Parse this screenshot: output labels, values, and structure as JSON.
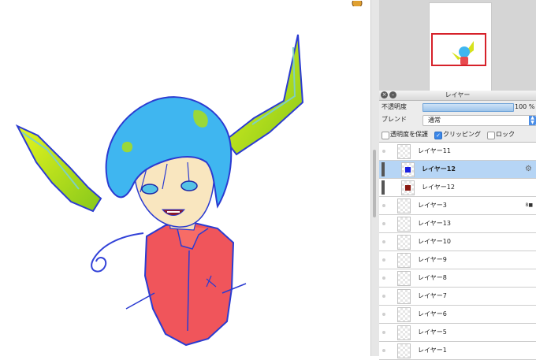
{
  "layer_panel": {
    "title": "レイヤー",
    "opacity_label": "不透明度",
    "opacity_value": "100 %",
    "opacity_fraction": 1.0,
    "blend_label": "ブレンド",
    "blend_value": "通常",
    "protect_transparency_label": "透明度を保護",
    "protect_transparency_checked": false,
    "clipping_label": "クリッピング",
    "clipping_checked": true,
    "lock_label": "ロック",
    "lock_checked": false,
    "layers": [
      {
        "name": "レイヤー11",
        "selected": false,
        "clipped": false
      },
      {
        "name": "レイヤー12",
        "selected": true,
        "clipped": true,
        "swatch": "#1b22e0"
      },
      {
        "name": "レイヤー12",
        "selected": false,
        "clipped": true,
        "swatch": "#8a1a12"
      },
      {
        "name": "レイヤー3",
        "selected": false,
        "clipped": false,
        "badge": "8■"
      },
      {
        "name": "レイヤー13",
        "selected": false,
        "clipped": false
      },
      {
        "name": "レイヤー10",
        "selected": false,
        "clipped": false
      },
      {
        "name": "レイヤー9",
        "selected": false,
        "clipped": false
      },
      {
        "name": "レイヤー8",
        "selected": false,
        "clipped": false
      },
      {
        "name": "レイヤー7",
        "selected": false,
        "clipped": false
      },
      {
        "name": "レイヤー6",
        "selected": false,
        "clipped": false
      },
      {
        "name": "レイヤー5",
        "selected": false,
        "clipped": false
      },
      {
        "name": "レイヤー1",
        "selected": false,
        "clipped": false
      }
    ]
  },
  "icons": {
    "close": "close-icon",
    "minimize": "minimize-icon",
    "settings": "gear-icon",
    "visibility": "eye-icon",
    "dropdown": "chevron-updown-icon"
  },
  "colors": {
    "selection": "#b6d5f5",
    "accent": "#3a86e8",
    "navigator_viewport": "#d6212a"
  }
}
